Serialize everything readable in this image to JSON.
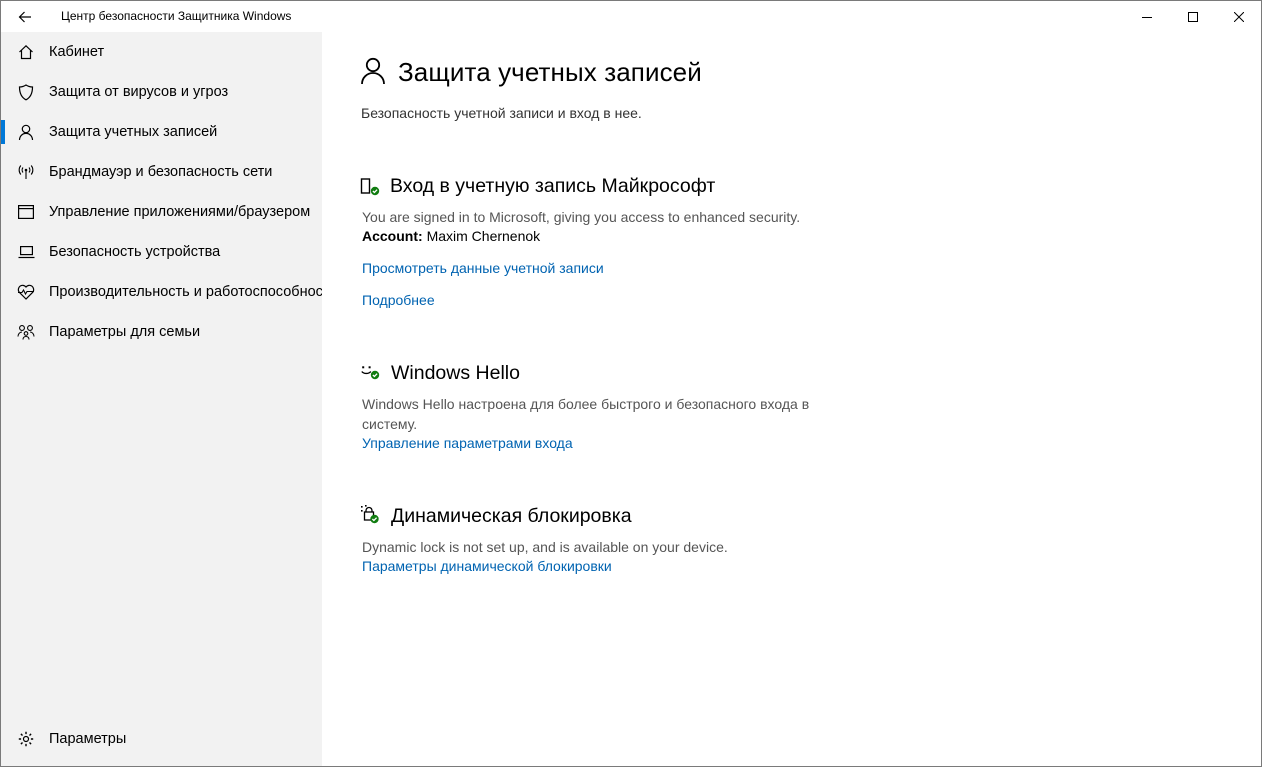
{
  "window": {
    "title": "Центр безопасности Защитника Windows"
  },
  "sidebar": {
    "items": [
      {
        "label": "Кабинет",
        "icon": "home-icon"
      },
      {
        "label": "Защита от вирусов и угроз",
        "icon": "shield-icon"
      },
      {
        "label": "Защита учетных записей",
        "icon": "person-icon",
        "selected": true
      },
      {
        "label": "Брандмауэр и безопасность сети",
        "icon": "wireless-antenna-icon"
      },
      {
        "label": "Управление приложениями/браузером",
        "icon": "app-window-icon"
      },
      {
        "label": "Безопасность устройства",
        "icon": "laptop-icon"
      },
      {
        "label": "Производительность и работоспособность устройства",
        "icon": "heart-pulse-icon"
      },
      {
        "label": "Параметры для семьи",
        "icon": "family-icon"
      }
    ],
    "settings_label": "Параметры"
  },
  "main": {
    "title": "Защита учетных записей",
    "subtitle": "Безопасность учетной записи и вход в нее.",
    "sections": [
      {
        "title": "Вход в учетную запись Майкрософт",
        "icon": "phone-check-icon",
        "description": "You are signed in to Microsoft, giving you access to enhanced security.",
        "account_label": "Account:",
        "account_value": "Maxim Chernenok",
        "links": [
          "Просмотреть данные учетной записи",
          "Подробнее"
        ]
      },
      {
        "title": "Windows Hello",
        "icon": "face-check-icon",
        "description": "Windows Hello настроена для более быстрого и безопасного входа в систему.",
        "links": [
          "Управление параметрами входа"
        ]
      },
      {
        "title": "Динамическая блокировка",
        "icon": "lock-check-icon",
        "description": "Dynamic lock is not set up, and is available on your device.",
        "links": [
          "Параметры динамической блокировки"
        ]
      }
    ]
  },
  "colors": {
    "accent": "#0078d7",
    "link": "#0063b1",
    "status_ok": "#107c10",
    "sidebar_bg": "#f2f2f2"
  }
}
